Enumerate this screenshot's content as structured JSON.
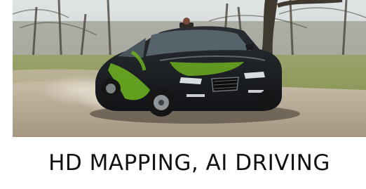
{
  "caption": "HD MAPPING, AI DRIVING",
  "colors": {
    "sky": "#cfd6d8",
    "trees": "#6f6a5e",
    "grass": "#8f9a55",
    "dirt": "#b6a88f",
    "car_body": "#1b1e22",
    "car_graphic": "#6cae1f",
    "caption_text": "#111111"
  }
}
